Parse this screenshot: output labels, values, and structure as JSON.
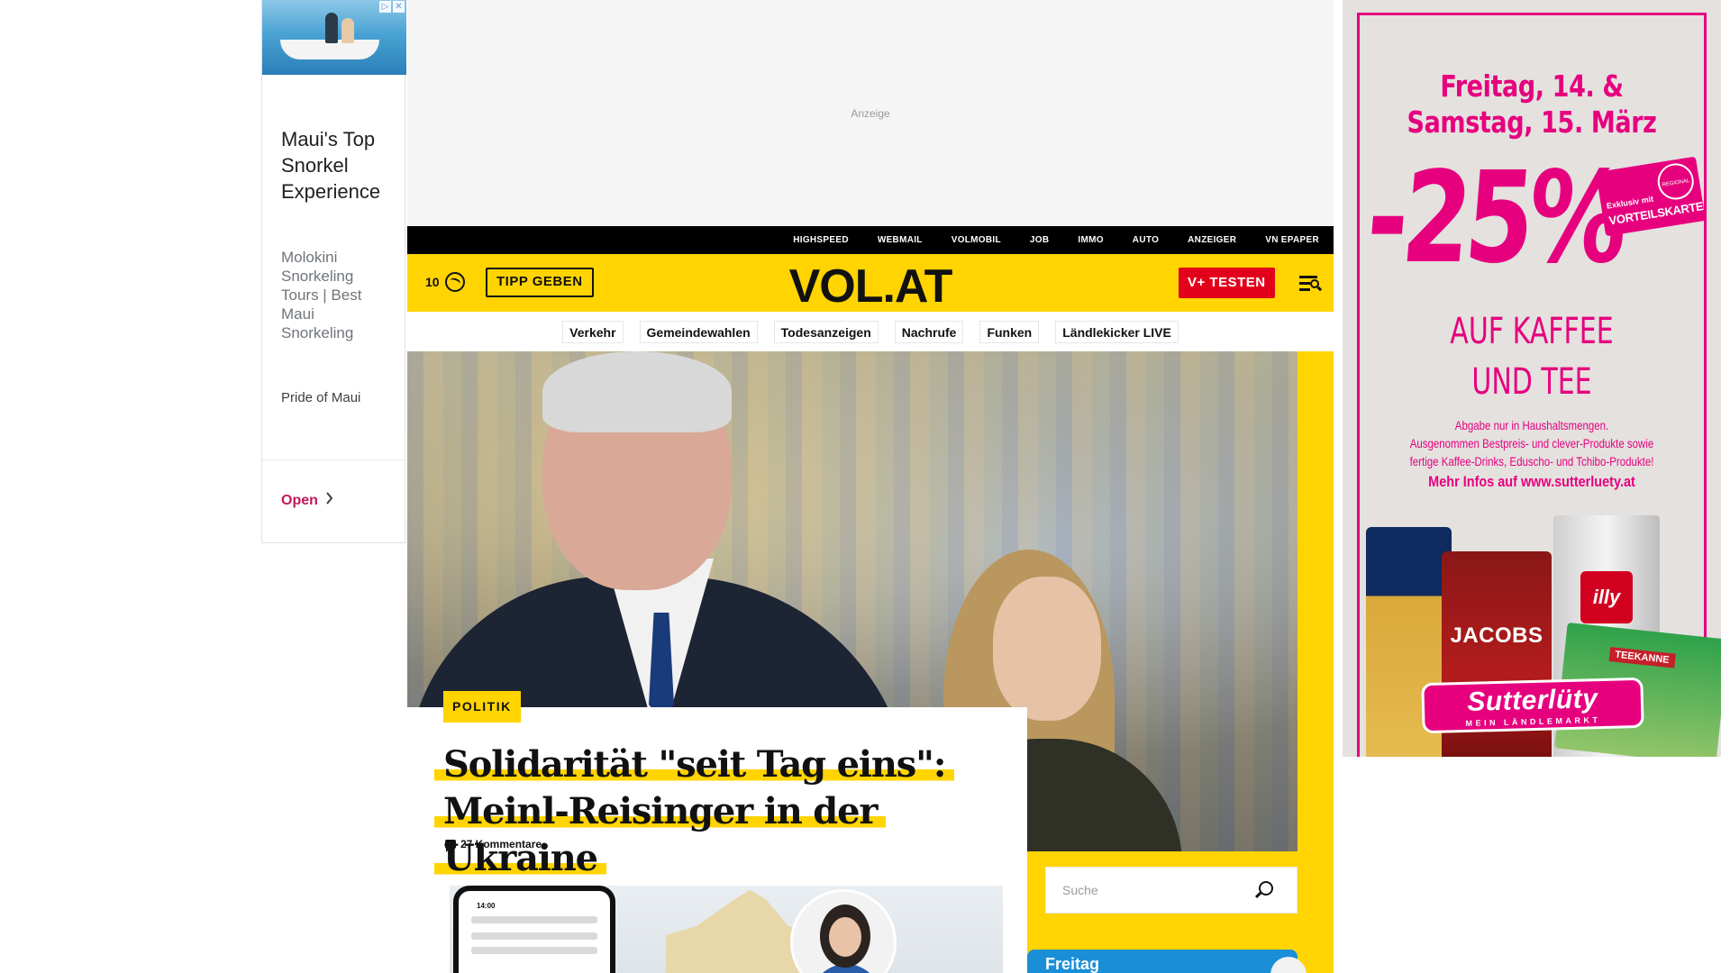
{
  "left_ad": {
    "title": "Maui's Top Snorkel Experience",
    "description": "Molokini Snorkeling Tours | Best Maui Snorkeling",
    "advertiser": "Pride of Maui",
    "cta": "Open",
    "icons": [
      "adchoices-icon",
      "close-icon"
    ]
  },
  "top_ad": {
    "label": "Anzeige"
  },
  "topbar": {
    "links": [
      "HIGHSPEED",
      "WEBMAIL",
      "VOLMOBIL",
      "JOB",
      "IMMO",
      "AUTO",
      "ANZEIGER",
      "VN EPAPER"
    ]
  },
  "header": {
    "temperature": "10",
    "weather_icon": "cloud-icon",
    "tip_button": "TIPP GEBEN",
    "logo": "VOL.AT",
    "subscribe_button": "V+ TESTEN",
    "menu_icon": "menu-search-icon"
  },
  "subnav": {
    "items": [
      "Verkehr",
      "Gemeindewahlen",
      "Todesanzeigen",
      "Nachrufe",
      "Funken",
      "Ländlekicker LIVE"
    ]
  },
  "hero": {
    "category": "POLITIK",
    "headline_line1": "Solidarität \"seit Tag eins\":",
    "headline_line2": "Meinl-Reisinger in der Ukraine",
    "comments": "27 Kommentare",
    "teaser_phone_time": "14:00"
  },
  "search": {
    "placeholder": "Suche"
  },
  "promo": {
    "label": "Freitag"
  },
  "right_ad": {
    "date_line1": "Freitag, 14. &",
    "date_line2": "Samstag, 15. März",
    "discount": "-25%",
    "stamp_line1": "Exklusiv mit",
    "stamp_line2": "VORTEILSKARTE",
    "stamp_seal": "REGIONAL",
    "product_line1": "AUF KAFFEE",
    "product_line2": "UND TEE",
    "fine_line1": "Abgabe nur in Haushaltsmengen.",
    "fine_line2": "Ausgenommen Bestpreis- und clever-Produkte sowie",
    "fine_line3": "fertige Kaffee-Drinks, Eduscho- und Tchibo-Produkte!",
    "more_info": "Mehr Infos auf www.sutterluety.at",
    "brand_jacobs": "JACOBS",
    "brand_illy": "illy",
    "brand_teekanne": "TEEKANNE",
    "store_name": "Sutterlüty",
    "store_tagline": "MEIN LÄNDLEMARKT",
    "brand_color": "#e6007e"
  },
  "colors": {
    "accent_yellow": "#ffd400",
    "subscribe_red": "#e3001b",
    "topbar_black": "#000000"
  }
}
